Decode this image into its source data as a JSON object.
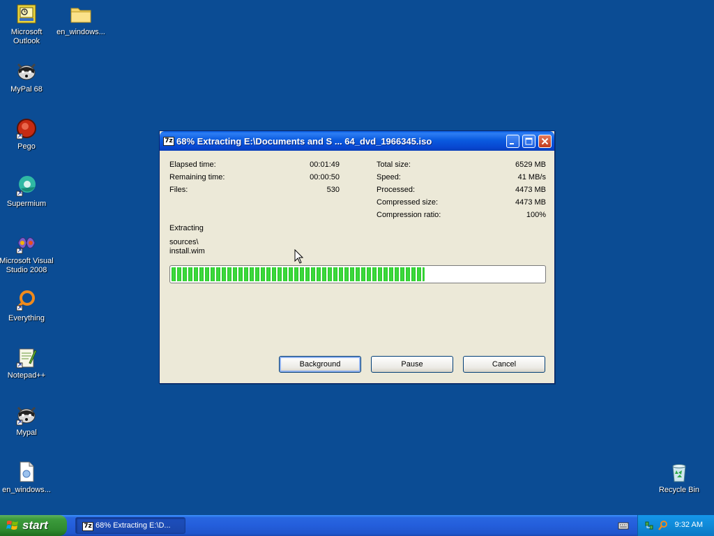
{
  "desktop": {
    "icons": [
      {
        "label": "Microsoft Outlook",
        "icon": "outlook-icon"
      },
      {
        "label": "en_windows...",
        "icon": "folder-icon"
      },
      {
        "label": "MyPal 68",
        "icon": "mypal-icon"
      },
      {
        "label": "Pego",
        "icon": "pego-icon"
      },
      {
        "label": "Supermium",
        "icon": "supermium-icon"
      },
      {
        "label": "Microsoft Visual Studio 2008",
        "icon": "visual-studio-icon"
      },
      {
        "label": "Everything",
        "icon": "everything-icon"
      },
      {
        "label": "Notepad++",
        "icon": "notepadpp-icon"
      },
      {
        "label": "Mypal",
        "icon": "mypal-icon"
      },
      {
        "label": "en_windows...",
        "icon": "document-icon"
      },
      {
        "label": "Recycle Bin",
        "icon": "recycle-bin-icon"
      }
    ]
  },
  "dialog": {
    "app_icon": "7z",
    "title": "68% Extracting E:\\Documents and S ... 64_dvd_1966345.iso",
    "left_stats": [
      {
        "label": "Elapsed time:",
        "value": "00:01:49"
      },
      {
        "label": "Remaining time:",
        "value": "00:00:50"
      },
      {
        "label": "Files:",
        "value": "530"
      }
    ],
    "right_stats": [
      {
        "label": "Total size:",
        "value": "6529 MB"
      },
      {
        "label": "Speed:",
        "value": "41 MB/s"
      },
      {
        "label": "Processed:",
        "value": "4473 MB"
      },
      {
        "label": "Compressed size:",
        "value": "4473 MB"
      },
      {
        "label": "Compression ratio:",
        "value": "100%"
      }
    ],
    "status_label": "Extracting",
    "current_path": "sources\\",
    "current_file": "install.wim",
    "progress_fraction": 0.68,
    "buttons": {
      "background": "Background",
      "pause": "Pause",
      "cancel": "Cancel"
    }
  },
  "taskbar": {
    "start_label": "start",
    "task_button": {
      "icon": "7z",
      "label": "68% Extracting E:\\D..."
    },
    "clock": "9:32 AM"
  },
  "colors": {
    "desktop": "#0b4c94",
    "titlebar": "#0a5be0",
    "progress": "#2bc42b"
  }
}
